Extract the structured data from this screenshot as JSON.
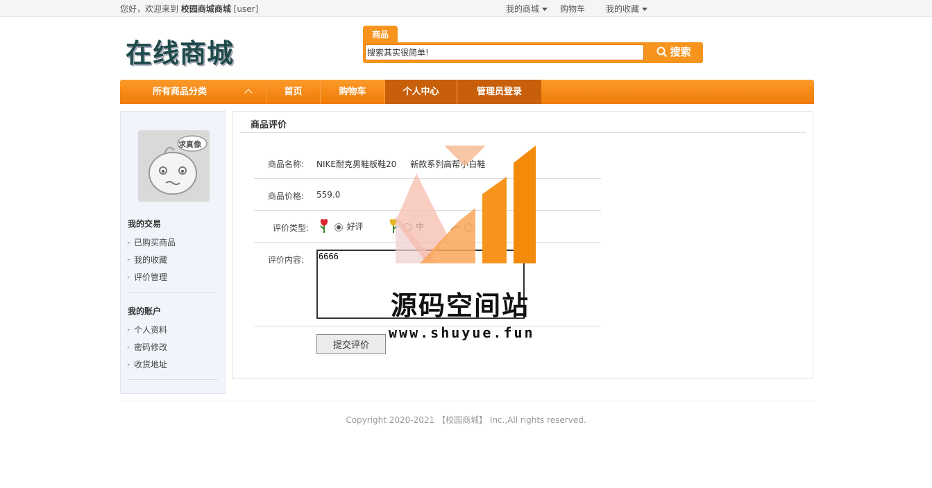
{
  "topbar": {
    "welcome_prefix": "您好，欢迎来到",
    "site_name": "校园商城商城",
    "user": "[user]",
    "links": [
      "我的商城",
      "购物车",
      "我的收藏"
    ]
  },
  "header": {
    "logo_text": "在线商城",
    "search_tab": "商品",
    "search_placeholder": "搜索其实很简单!",
    "search_button": "搜索"
  },
  "nav": {
    "categories": "所有商品分类",
    "items": [
      "首页",
      "购物车",
      "个人中心",
      "管理员登录"
    ]
  },
  "sidebar": {
    "avatar_tag": "求真像",
    "section1": "我的交易",
    "section1_items": [
      "已购买商品",
      "我的收藏",
      "评价管理"
    ],
    "section2": "我的账户",
    "section2_items": [
      "个人资料",
      "密码修改",
      "收货地址"
    ]
  },
  "review": {
    "title": "商品评价",
    "name_label": "商品名称:",
    "name_value": "NIKE耐克男鞋板鞋20",
    "name_value_tail": "新款系列高帮小白鞋",
    "price_label": "商品价格:",
    "price_value": "559.0",
    "type_label": "评价类型:",
    "type_good": "好评",
    "type_mid_partial": "中",
    "content_label": "评价内容:",
    "content_value": "6666",
    "submit": "提交评价"
  },
  "watermark": {
    "title": "源码空间站",
    "url": "www.shuyue.fun"
  },
  "footer": {
    "copyright": "Copyright 2020-2021 【校园商城】 Inc.,All rights reserved."
  },
  "colors": {
    "accent": "#f7941d",
    "nav_dark": "#c85f0b"
  }
}
